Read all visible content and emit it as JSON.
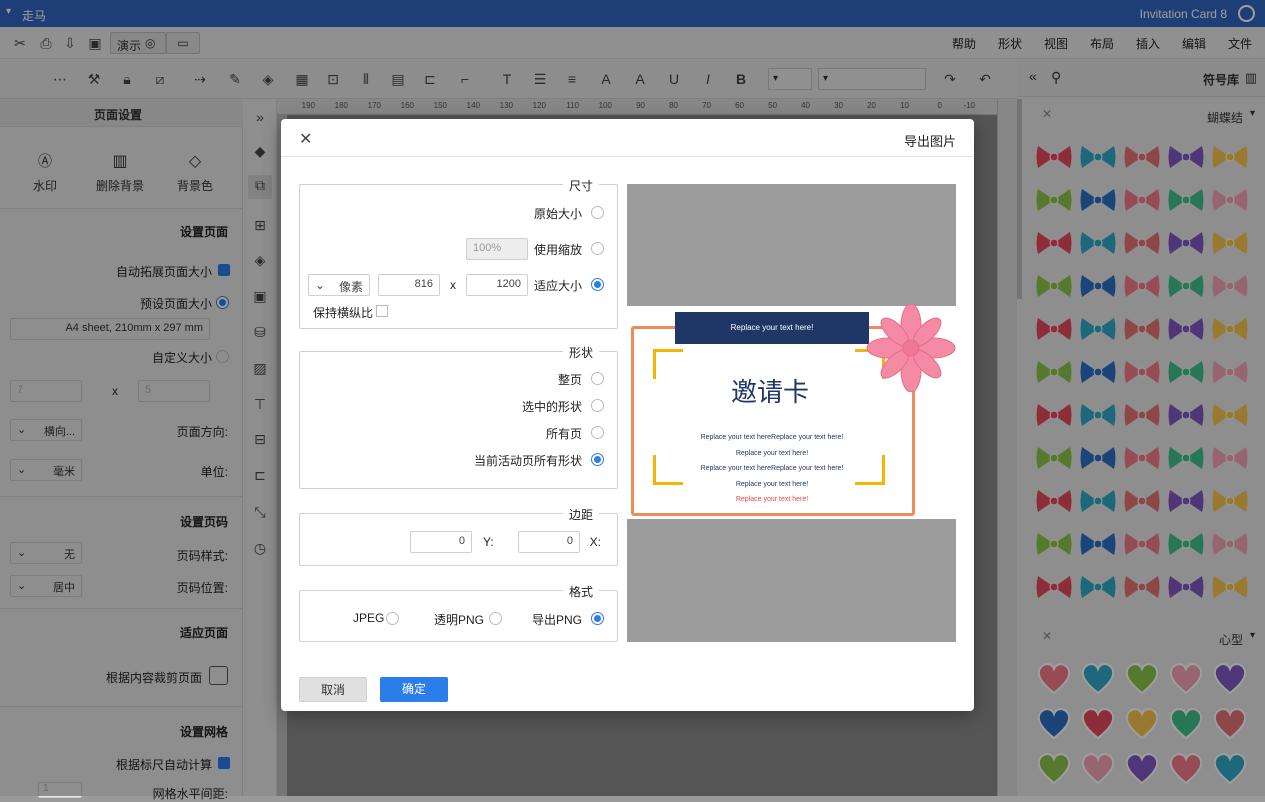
{
  "app": {
    "title": "Invitation Card 8",
    "doc_label": "走马"
  },
  "menu": [
    "文件",
    "编辑",
    "插入",
    "布局",
    "视图",
    "形状",
    "帮助"
  ],
  "quick": {
    "present_label": "演示"
  },
  "left_panel": {
    "title": "页面设置",
    "top_buttons": [
      {
        "label": "背景色"
      },
      {
        "label": "删除背景"
      },
      {
        "label": "水印"
      }
    ],
    "set_page_size": "设置页面",
    "auto_expand": "自动拓展页面大小",
    "preset_size": "预设页面大小",
    "paper": "A4 sheet, 210mm x 297 mm",
    "custom_size": "自定义大小",
    "custom_w": "5",
    "custom_x": "x",
    "custom_h": "7",
    "orientation_label": "页面方向:",
    "orientation_value": "横向...",
    "unit_label": "单位:",
    "unit_value": "毫米",
    "page_number_head": "设置页码",
    "pn_style_label": "页码样式:",
    "pn_style_value": "无",
    "pn_pos_label": "页码位置:",
    "pn_pos_value": "居中",
    "fit_head": "适应页面",
    "fit_crop": "根据内容裁剪页面",
    "grid_head": "设置网格",
    "grid_auto": "根据标尺自动计算",
    "grid_h": "网格水平间距:",
    "grid_h_value": "1"
  },
  "ruler_labels": [
    "-10",
    "0",
    "10",
    "20",
    "30",
    "40",
    "50",
    "60",
    "70",
    "80",
    "90",
    "100",
    "110",
    "120",
    "130",
    "140",
    "150",
    "160",
    "170",
    "180",
    "190"
  ],
  "right_panel": {
    "title": "符号库",
    "section1": "蝴蝶结",
    "section2": "心型"
  },
  "dialog": {
    "title": "导出图片",
    "size": {
      "legend": "尺寸",
      "original": "原始大小",
      "use_zoom": "使用缩放",
      "zoom_value": "100%",
      "fit": "适应大小",
      "width": "1200",
      "x": "x",
      "height": "816",
      "unit": "像素",
      "keep_ratio": "保持横纵比"
    },
    "shape": {
      "legend": "形状",
      "whole_page": "整页",
      "selected": "选中的形状",
      "all_pages": "所有页",
      "current": "当前活动页所有形状"
    },
    "margin": {
      "legend": "边距",
      "x_label": "X:",
      "x_value": "0",
      "y_label": "Y:",
      "y_value": "0"
    },
    "format": {
      "legend": "格式",
      "png": "导出PNG",
      "transparent": "透明PNG",
      "jpeg": "JPEG"
    },
    "ok": "确定",
    "cancel": "取消",
    "preview": {
      "banner": "Replace your text here!",
      "heading": "邀请卡",
      "lines": [
        "Replace your text hereReplace your text here!",
        "Replace your text here!",
        "Replace your text hereReplace your text here!",
        "Replace your text here!",
        "Replace your text here!"
      ]
    }
  },
  "colors": {
    "accent": "#2b7de9",
    "titlebar": "#2f64c0",
    "card_border": "#f08a5d",
    "banner": "#1f3766",
    "bracket": "#f5b400"
  }
}
